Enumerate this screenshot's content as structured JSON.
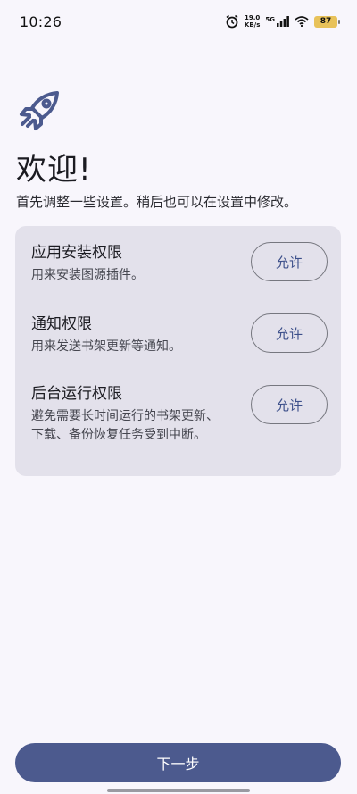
{
  "status_bar": {
    "time": "10:26",
    "net_speed_value": "19.0",
    "net_speed_unit": "KB/s",
    "network_type": "5G",
    "battery_level": "87",
    "icons": [
      "alarm-icon",
      "signal-icon",
      "wifi-icon",
      "battery-icon"
    ]
  },
  "welcome": {
    "icon": "rocket-icon",
    "title": "欢迎!",
    "subtitle": "首先调整一些设置。稍后也可以在设置中修改。"
  },
  "permissions": {
    "items": [
      {
        "title": "应用安装权限",
        "description": "用来安装图源插件。",
        "button_label": "允许"
      },
      {
        "title": "通知权限",
        "description": "用来发送书架更新等通知。",
        "button_label": "允许"
      },
      {
        "title": "后台运行权限",
        "description": "避免需要长时间运行的书架更新、下载、备份恢复任务受到中断。",
        "button_label": "允许"
      }
    ]
  },
  "footer": {
    "next_label": "下一步"
  },
  "colors": {
    "accent": "#4c5a8e",
    "card_bg": "#e3e1eb",
    "background": "#f8f6fc",
    "battery": "#e8c25a"
  }
}
